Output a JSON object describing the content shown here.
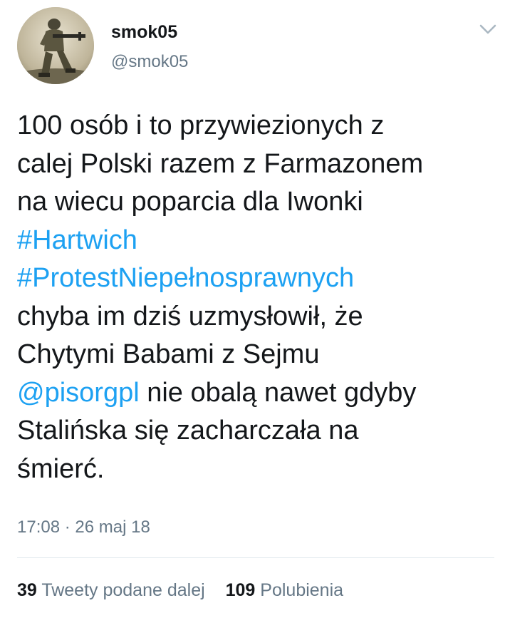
{
  "author": {
    "display_name": "smok05",
    "handle": "@smok05",
    "avatar_icon": "soldier-avatar-icon"
  },
  "menu": {
    "icon": "chevron-down-icon",
    "color": "#aab8c2"
  },
  "tweet": {
    "lines": [
      [
        {
          "text": "100 osób i to przywiezionych z",
          "link": false
        }
      ],
      [
        {
          "text": "calej Polski razem z Farmazonem",
          "link": false
        }
      ],
      [
        {
          "text": "na wiecu poparcia dla Iwonki",
          "link": false
        }
      ],
      [
        {
          "text": "#Hartwich",
          "link": true
        }
      ],
      [
        {
          "text": "#ProtestNiepełnosprawnych",
          "link": true
        }
      ],
      [
        {
          "text": "chyba im dziś uzmysłowił, że",
          "link": false
        }
      ],
      [
        {
          "text": "Chytymi Babami z Sejmu",
          "link": false
        }
      ],
      [
        {
          "text": "@pisorgpl",
          "link": true
        },
        {
          "text": " nie obalą nawet gdyby",
          "link": false
        }
      ],
      [
        {
          "text": "Stalińska się zacharczała na",
          "link": false
        }
      ],
      [
        {
          "text": "śmierć.",
          "link": false
        }
      ]
    ],
    "timestamp": "17:08 · 26 maj 18"
  },
  "stats": {
    "retweets_count": "39",
    "retweets_label": "Tweety podane dalej",
    "likes_count": "109",
    "likes_label": "Polubienia"
  },
  "colors": {
    "link": "#1da1f2",
    "text": "#14171a",
    "secondary": "#657786",
    "divider": "#e1e8ed"
  }
}
